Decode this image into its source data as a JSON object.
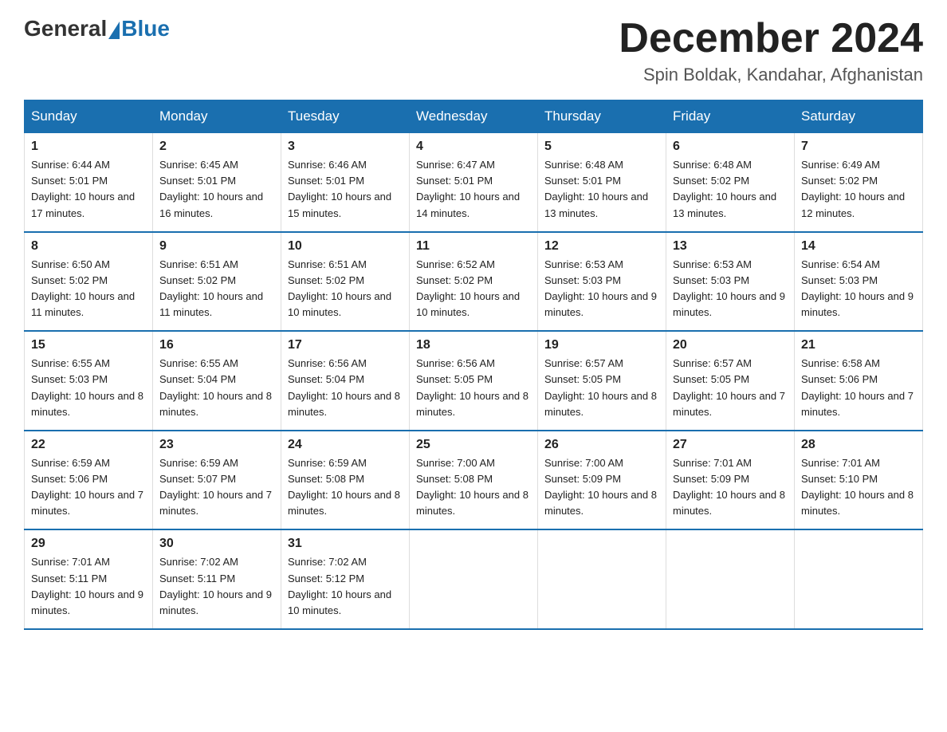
{
  "header": {
    "logo_general": "General",
    "logo_blue": "Blue",
    "month_title": "December 2024",
    "location": "Spin Boldak, Kandahar, Afghanistan"
  },
  "days_of_week": [
    "Sunday",
    "Monday",
    "Tuesday",
    "Wednesday",
    "Thursday",
    "Friday",
    "Saturday"
  ],
  "weeks": [
    [
      {
        "day": "1",
        "sunrise": "6:44 AM",
        "sunset": "5:01 PM",
        "daylight": "10 hours and 17 minutes."
      },
      {
        "day": "2",
        "sunrise": "6:45 AM",
        "sunset": "5:01 PM",
        "daylight": "10 hours and 16 minutes."
      },
      {
        "day": "3",
        "sunrise": "6:46 AM",
        "sunset": "5:01 PM",
        "daylight": "10 hours and 15 minutes."
      },
      {
        "day": "4",
        "sunrise": "6:47 AM",
        "sunset": "5:01 PM",
        "daylight": "10 hours and 14 minutes."
      },
      {
        "day": "5",
        "sunrise": "6:48 AM",
        "sunset": "5:01 PM",
        "daylight": "10 hours and 13 minutes."
      },
      {
        "day": "6",
        "sunrise": "6:48 AM",
        "sunset": "5:02 PM",
        "daylight": "10 hours and 13 minutes."
      },
      {
        "day": "7",
        "sunrise": "6:49 AM",
        "sunset": "5:02 PM",
        "daylight": "10 hours and 12 minutes."
      }
    ],
    [
      {
        "day": "8",
        "sunrise": "6:50 AM",
        "sunset": "5:02 PM",
        "daylight": "10 hours and 11 minutes."
      },
      {
        "day": "9",
        "sunrise": "6:51 AM",
        "sunset": "5:02 PM",
        "daylight": "10 hours and 11 minutes."
      },
      {
        "day": "10",
        "sunrise": "6:51 AM",
        "sunset": "5:02 PM",
        "daylight": "10 hours and 10 minutes."
      },
      {
        "day": "11",
        "sunrise": "6:52 AM",
        "sunset": "5:02 PM",
        "daylight": "10 hours and 10 minutes."
      },
      {
        "day": "12",
        "sunrise": "6:53 AM",
        "sunset": "5:03 PM",
        "daylight": "10 hours and 9 minutes."
      },
      {
        "day": "13",
        "sunrise": "6:53 AM",
        "sunset": "5:03 PM",
        "daylight": "10 hours and 9 minutes."
      },
      {
        "day": "14",
        "sunrise": "6:54 AM",
        "sunset": "5:03 PM",
        "daylight": "10 hours and 9 minutes."
      }
    ],
    [
      {
        "day": "15",
        "sunrise": "6:55 AM",
        "sunset": "5:03 PM",
        "daylight": "10 hours and 8 minutes."
      },
      {
        "day": "16",
        "sunrise": "6:55 AM",
        "sunset": "5:04 PM",
        "daylight": "10 hours and 8 minutes."
      },
      {
        "day": "17",
        "sunrise": "6:56 AM",
        "sunset": "5:04 PM",
        "daylight": "10 hours and 8 minutes."
      },
      {
        "day": "18",
        "sunrise": "6:56 AM",
        "sunset": "5:05 PM",
        "daylight": "10 hours and 8 minutes."
      },
      {
        "day": "19",
        "sunrise": "6:57 AM",
        "sunset": "5:05 PM",
        "daylight": "10 hours and 8 minutes."
      },
      {
        "day": "20",
        "sunrise": "6:57 AM",
        "sunset": "5:05 PM",
        "daylight": "10 hours and 7 minutes."
      },
      {
        "day": "21",
        "sunrise": "6:58 AM",
        "sunset": "5:06 PM",
        "daylight": "10 hours and 7 minutes."
      }
    ],
    [
      {
        "day": "22",
        "sunrise": "6:59 AM",
        "sunset": "5:06 PM",
        "daylight": "10 hours and 7 minutes."
      },
      {
        "day": "23",
        "sunrise": "6:59 AM",
        "sunset": "5:07 PM",
        "daylight": "10 hours and 7 minutes."
      },
      {
        "day": "24",
        "sunrise": "6:59 AM",
        "sunset": "5:08 PM",
        "daylight": "10 hours and 8 minutes."
      },
      {
        "day": "25",
        "sunrise": "7:00 AM",
        "sunset": "5:08 PM",
        "daylight": "10 hours and 8 minutes."
      },
      {
        "day": "26",
        "sunrise": "7:00 AM",
        "sunset": "5:09 PM",
        "daylight": "10 hours and 8 minutes."
      },
      {
        "day": "27",
        "sunrise": "7:01 AM",
        "sunset": "5:09 PM",
        "daylight": "10 hours and 8 minutes."
      },
      {
        "day": "28",
        "sunrise": "7:01 AM",
        "sunset": "5:10 PM",
        "daylight": "10 hours and 8 minutes."
      }
    ],
    [
      {
        "day": "29",
        "sunrise": "7:01 AM",
        "sunset": "5:11 PM",
        "daylight": "10 hours and 9 minutes."
      },
      {
        "day": "30",
        "sunrise": "7:02 AM",
        "sunset": "5:11 PM",
        "daylight": "10 hours and 9 minutes."
      },
      {
        "day": "31",
        "sunrise": "7:02 AM",
        "sunset": "5:12 PM",
        "daylight": "10 hours and 10 minutes."
      },
      null,
      null,
      null,
      null
    ]
  ]
}
